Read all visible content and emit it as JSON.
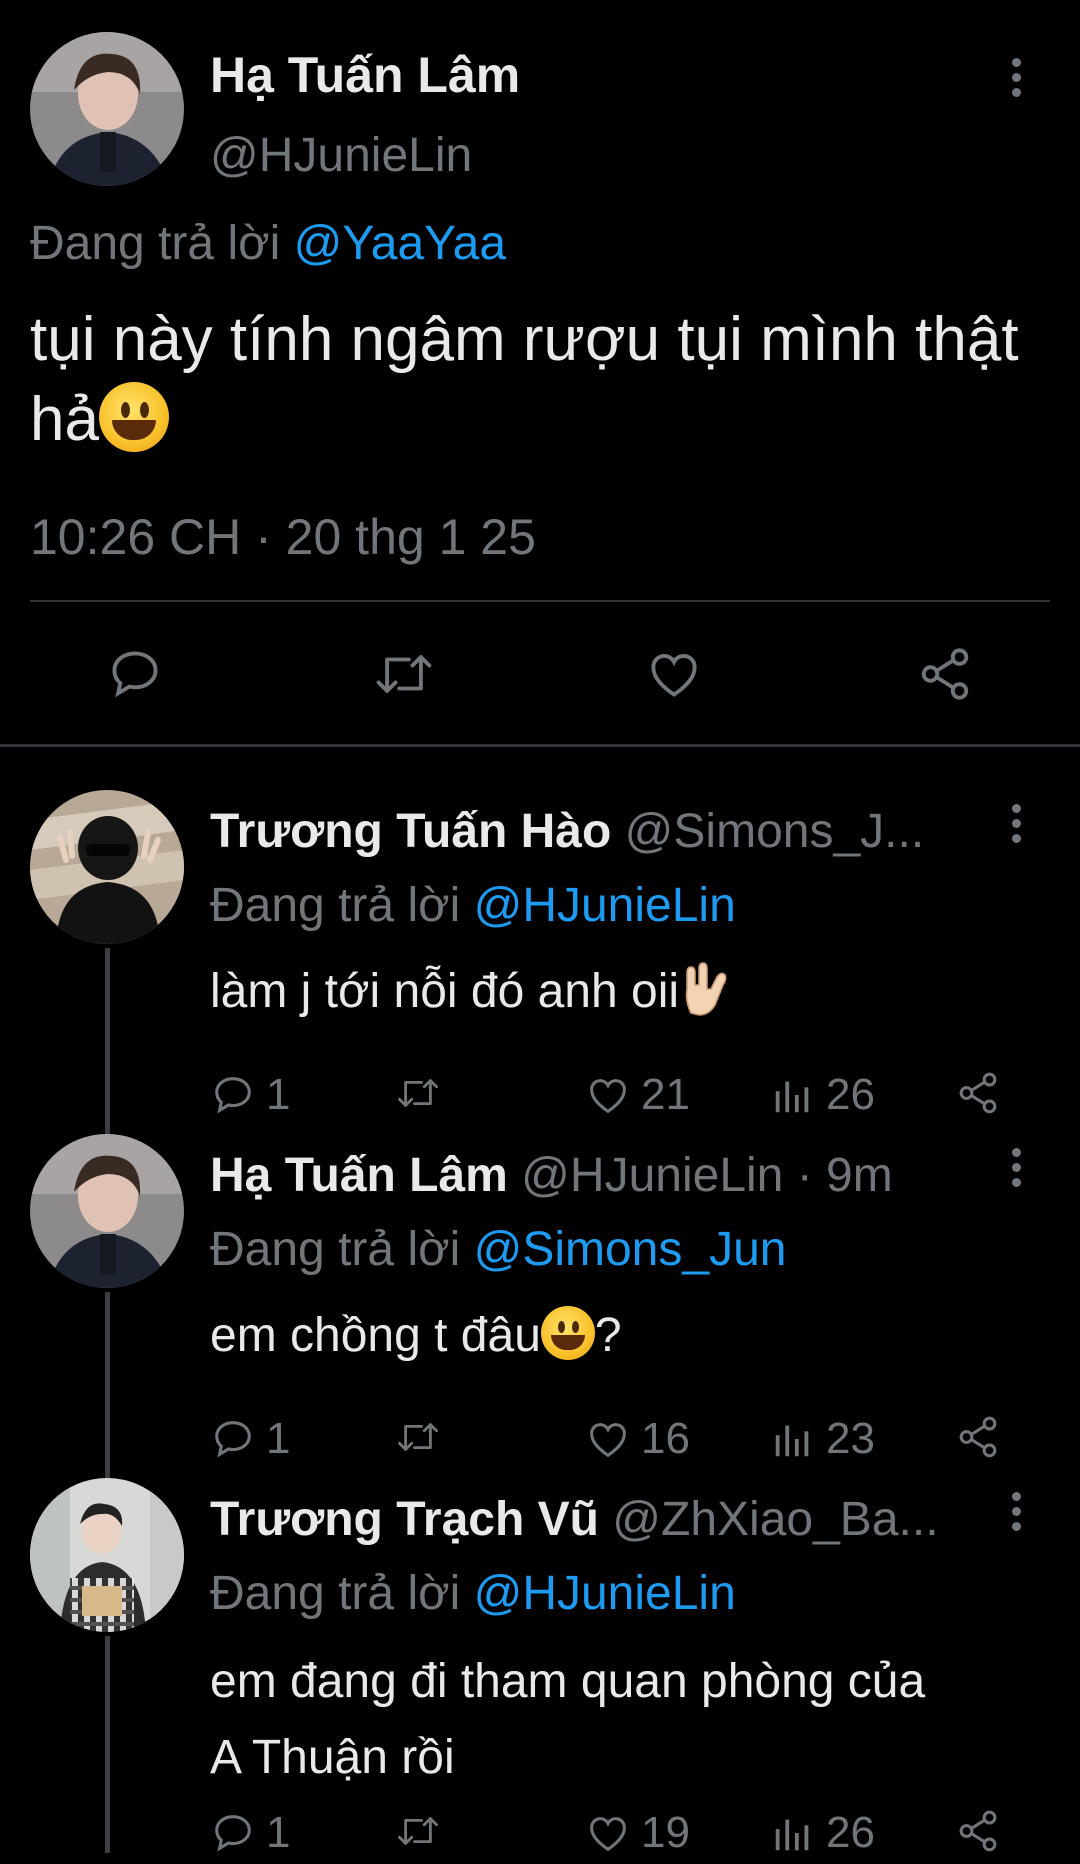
{
  "main_tweet": {
    "author_name": "Hạ Tuấn Lâm",
    "author_handle": "@HJunieLin",
    "replying_prefix": "Đang trả lời",
    "replying_to": "@YaaYaa",
    "text": "tụi này tính ngâm rượu tụi mình thật hả",
    "emoji": "grinning-face",
    "timestamp": "10:26 CH · 20 thg 1 25",
    "actions": [
      "reply-icon",
      "retweet-icon",
      "like-icon",
      "share-icon"
    ]
  },
  "replies": [
    {
      "author_name": "Trương Tuấn Hào",
      "author_handle": "@Simons_J...",
      "time": "",
      "replying_prefix": "Đang trả lời",
      "replying_to": "@HJunieLin",
      "text": "làm j tới nỗi đó anh oii",
      "emoji": "love-you-gesture",
      "replies": "1",
      "retweets": "",
      "likes": "21",
      "views": "26"
    },
    {
      "author_name": "Hạ Tuấn Lâm",
      "author_handle": "@HJunieLin",
      "time": "· 9m",
      "replying_prefix": "Đang trả lời",
      "replying_to": "@Simons_Jun",
      "text_before": "em chồng t đâu",
      "text_after": "?",
      "emoji": "grinning-face",
      "replies": "1",
      "retweets": "",
      "likes": "16",
      "views": "23"
    },
    {
      "author_name": "Trương Trạch Vũ",
      "author_handle": "@ZhXiao_Ba...",
      "time": "",
      "replying_prefix": "Đang trả lời",
      "replying_to": "@HJunieLin",
      "text_line1": "em đang đi tham quan phòng của",
      "text_line2": "A Thuận rồi",
      "replies": "1",
      "retweets": "",
      "likes": "19",
      "views": "26"
    }
  ],
  "colors": {
    "background": "#000000",
    "text": "#e7e9ea",
    "secondary": "#71767b",
    "link": "#1d9bf0",
    "divider": "#2f3336"
  }
}
